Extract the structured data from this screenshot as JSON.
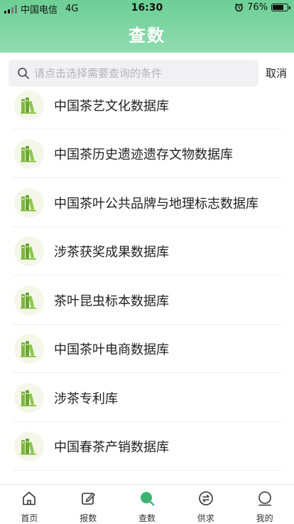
{
  "status_bar": {
    "carrier": "中国电信",
    "network": "4G",
    "time": "16:30",
    "battery": "76%",
    "battery_level": 0.76
  },
  "header": {
    "title": "查数"
  },
  "search": {
    "placeholder": "请点击选择需要查询的条件",
    "value": "",
    "cancel_label": "取消"
  },
  "databases": [
    {
      "label": "中国茶艺文化数据库"
    },
    {
      "label": "中国茶历史遗迹遗存文物数据库"
    },
    {
      "label": "中国茶叶公共品牌与地理标志数据库"
    },
    {
      "label": "涉茶获奖成果数据库"
    },
    {
      "label": "茶叶昆虫标本数据库"
    },
    {
      "label": "中国茶叶电商数据库"
    },
    {
      "label": "涉茶专利库"
    },
    {
      "label": "中国春茶产销数据库"
    }
  ],
  "tabbar": {
    "items": [
      {
        "label": "首页",
        "icon": "home-icon"
      },
      {
        "label": "报数",
        "icon": "edit-icon"
      },
      {
        "label": "查数",
        "icon": "search-icon",
        "active": true
      },
      {
        "label": "供求",
        "icon": "exchange-icon"
      },
      {
        "label": "我的",
        "icon": "user-icon"
      }
    ],
    "active_color": "#3cb371"
  },
  "colors": {
    "header_gradient_top": "#6ccf95",
    "header_gradient_bottom": "#8fdcaf",
    "db_icon_green": "#7cb83a"
  }
}
